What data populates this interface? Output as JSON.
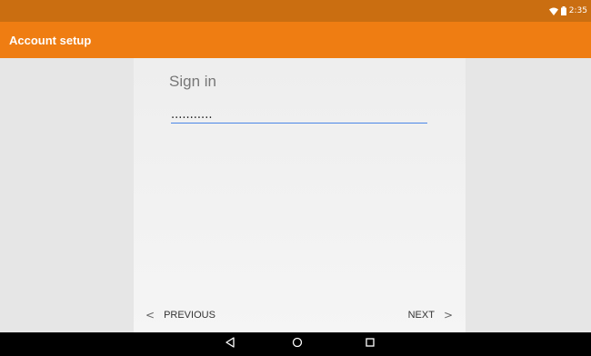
{
  "status_bar": {
    "time": "2:35",
    "icons": [
      "wifi-icon",
      "battery-icon"
    ]
  },
  "app_bar": {
    "title": "Account setup"
  },
  "form": {
    "title": "Sign in",
    "password_value": "..........."
  },
  "navigation": {
    "previous_label": "PREVIOUS",
    "next_label": "NEXT",
    "previous_chevron": "<",
    "next_chevron": ">"
  },
  "system_nav": {
    "buttons": [
      "back-icon",
      "home-icon",
      "recents-icon"
    ]
  },
  "colors": {
    "status_bar": "#ca6e11",
    "app_bar": "#ef7d12",
    "field_underline": "#4a86e8",
    "background": "#e6e6e6"
  }
}
